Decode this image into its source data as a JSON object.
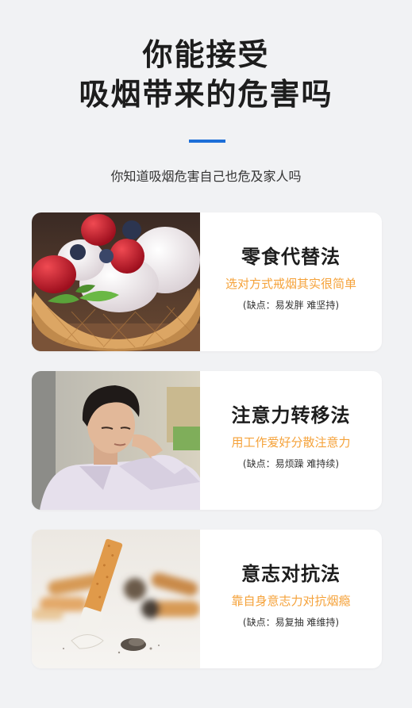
{
  "header": {
    "title_line1": "你能接受",
    "title_line2": "吸烟带来的危害吗",
    "subtitle": "你知道吸烟危害自己也危及家人吗"
  },
  "colors": {
    "accent": "#1d6fd8",
    "highlight": "#f5a23a",
    "background": "#f1f2f4"
  },
  "cards": [
    {
      "method": "零食代替法",
      "desc": "选对方式戒烟其实很简单",
      "note": "(缺点：易发胖 难坚持)"
    },
    {
      "method": "注意力转移法",
      "desc": "用工作爱好分散注意力",
      "note": "(缺点：易烦躁 难持续)"
    },
    {
      "method": "意志对抗法",
      "desc": "靠自身意志力对抗烟瘾",
      "note": "(缺点：易复抽 难维持)"
    }
  ]
}
